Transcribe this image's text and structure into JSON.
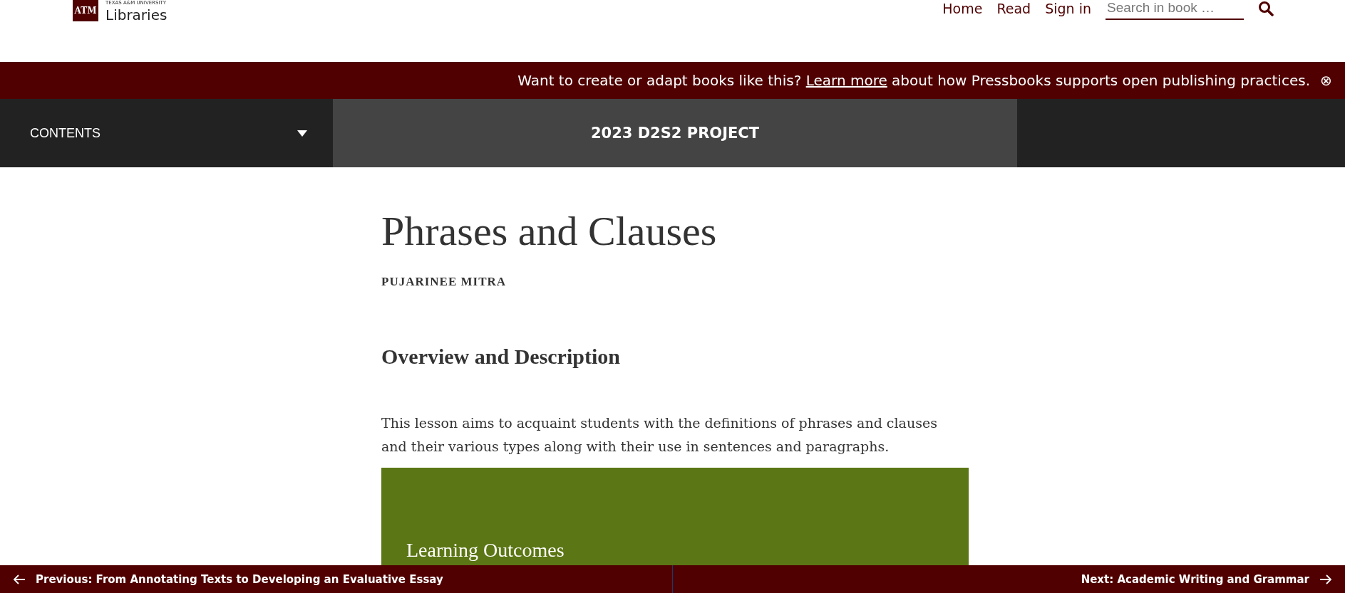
{
  "header": {
    "logo": {
      "mark": "ATM",
      "small_text": "TEXAS A&M UNIVERSITY",
      "name": "Libraries"
    },
    "nav": [
      "Home",
      "Read",
      "Sign in"
    ],
    "search": {
      "placeholder": "Search in book …"
    }
  },
  "banner": {
    "text": "Want to create or adapt books like this?",
    "link": "Learn more",
    "text_after": "about how Pressbooks supports open publishing practices.",
    "close": "⊗"
  },
  "bookbar": {
    "contents": {
      "label": "CONTENTS",
      "expanded": false
    },
    "title": "2023 D2S2 PROJECT"
  },
  "chapter": {
    "title": "Phrases and Clauses",
    "author": "PUJARINEE MITRA",
    "section_heading": "Overview and Description",
    "paragraph": "This lesson aims to acquaint students with the definitions of phrases and clauses and their various types along with their use in sentences and paragraphs.",
    "box_title": "Learning Outcomes"
  },
  "footer_nav": {
    "previous": "Previous: From Annotating Texts to Developing an Evaluative Essay",
    "next": "Next: Academic Writing and Grammar"
  }
}
